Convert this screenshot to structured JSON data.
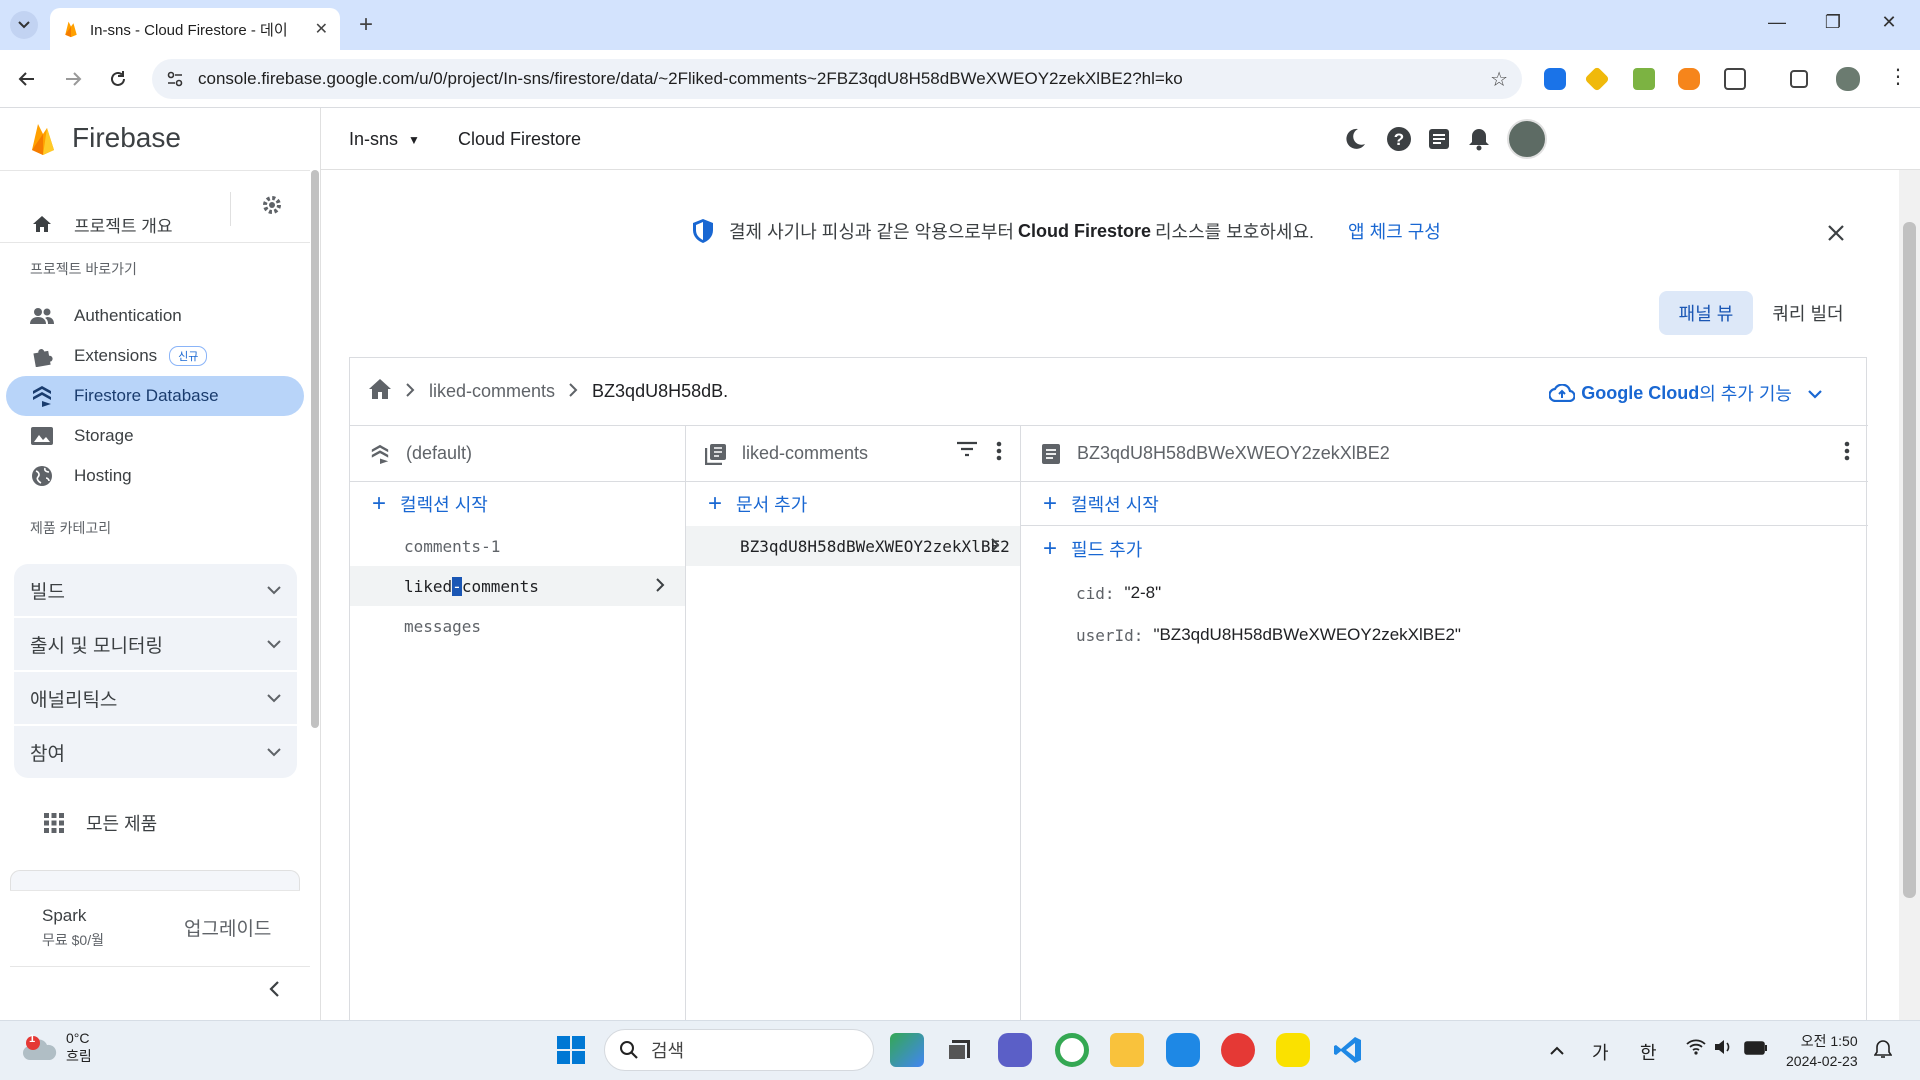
{
  "browser": {
    "tab_title": "In-sns - Cloud Firestore - 데이",
    "url": "console.firebase.google.com/u/0/project/In-sns/firestore/data/~2Fliked-comments~2FBZ3qdU8H58dBWeXWEOY2zekXlBE2?hl=ko"
  },
  "sidebar": {
    "brand": "Firebase",
    "overview": "프로젝트 개요",
    "shortcuts_header": "프로젝트 바로가기",
    "items": [
      {
        "label": "Authentication",
        "icon": "people-icon"
      },
      {
        "label": "Extensions",
        "icon": "puzzle-icon",
        "badge": "신규"
      },
      {
        "label": "Firestore Database",
        "icon": "firestore-icon",
        "active": true
      },
      {
        "label": "Storage",
        "icon": "image-icon"
      },
      {
        "label": "Hosting",
        "icon": "globe-icon"
      }
    ],
    "categories_header": "제품 카테고리",
    "categories": [
      "빌드",
      "출시 및 모니터링",
      "애널리틱스",
      "참여"
    ],
    "all_products": "모든 제품",
    "plan_name": "Spark",
    "plan_price": "무료 $0/월",
    "upgrade": "업그레이드"
  },
  "topbar": {
    "project": "In-sns",
    "product": "Cloud Firestore"
  },
  "banner": {
    "text_before": "결제 사기나 피싱과 같은 악용으로부터",
    "text_strong": "Cloud Firestore",
    "text_after": "리소스를 보호하세요.",
    "link": "앱 체크 구성"
  },
  "view_toggle": {
    "panel": "패널 뷰",
    "query": "쿼리 빌더"
  },
  "breadcrumb": {
    "collection": "liked-comments",
    "document": "BZ3qdU8H58dB."
  },
  "gcloud": {
    "strong": "Google Cloud",
    "rest": "의 추가 기능"
  },
  "columns": {
    "root": {
      "title": "(default)",
      "add": "컬렉션 시작",
      "collections": [
        "comments-1",
        "liked-comments",
        "messages"
      ]
    },
    "collection": {
      "title": "liked-comments",
      "add": "문서 추가",
      "documents": [
        "BZ3qdU8H58dBWeXWEOY2zekXlBE2"
      ]
    },
    "document": {
      "title": "BZ3qdU8H58dBWeXWEOY2zekXlBE2",
      "add_collection": "컬렉션 시작",
      "add_field": "필드 추가",
      "fields": [
        {
          "key": "cid:",
          "value": "\"2-8\""
        },
        {
          "key": "userId:",
          "value": "\"BZ3qdU8H58dBWeXWEOY2zekXlBE2\""
        }
      ]
    }
  },
  "selected_collection_parts": {
    "before": "liked",
    "caret": "-",
    "after": "comments"
  },
  "taskbar": {
    "temp": "0°C",
    "weather": "흐림",
    "weather_alert": "1",
    "search": "검색",
    "ime1": "가",
    "ime2": "한",
    "time": "오전 1:50",
    "date": "2024-02-23"
  },
  "colors": {
    "accent": "#1967d2",
    "active_nav": "#b8d4f9",
    "firebase_orange": "#ffa000"
  }
}
